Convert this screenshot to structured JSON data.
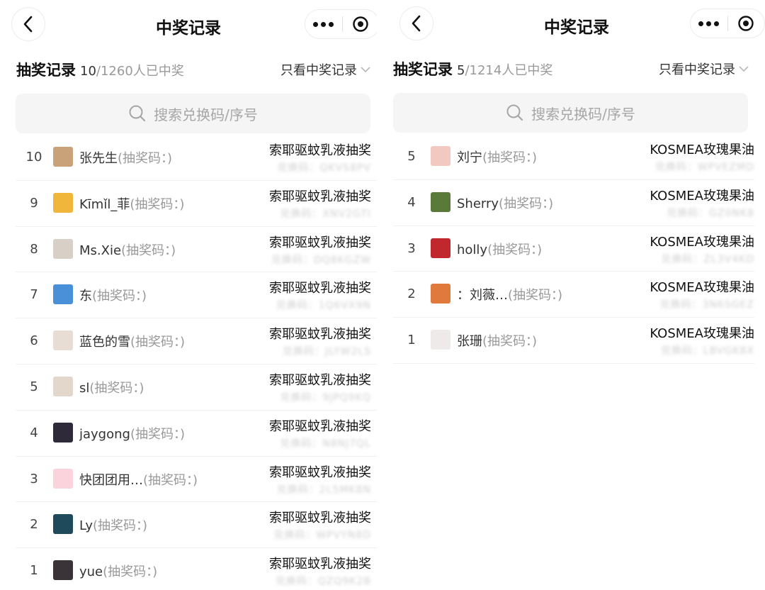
{
  "left": {
    "nav_title": "中奖记录",
    "summary_title": "抽奖记录",
    "summary_count": "10",
    "summary_total": "/1260人已中奖",
    "filter_label": "只看中奖记录",
    "search_placeholder": "搜索兑换码/序号",
    "rows": [
      {
        "index": "10",
        "name": "张先生",
        "code_label": "(抽奖码：)",
        "prize": "索耶驱蚊乳液抽奖",
        "code": "兑换码：QKVS8PV",
        "avatar_color": "#c9a27a"
      },
      {
        "index": "9",
        "name": "Kīmǐl_菲",
        "code_label": "(抽奖码：)",
        "prize": "索耶驱蚊乳液抽奖",
        "code": "兑换码：XNV2GTI",
        "avatar_color": "#f0b63c"
      },
      {
        "index": "8",
        "name": "Ms.Xie",
        "code_label": "(抽奖码：)",
        "prize": "索耶驱蚊乳液抽奖",
        "code": "兑换码：DQ8KGZW",
        "avatar_color": "#d8cfc6"
      },
      {
        "index": "7",
        "name": "东",
        "code_label": "(抽奖码：)",
        "prize": "索耶驱蚊乳液抽奖",
        "code": "兑换码：1Q6VX9N",
        "avatar_color": "#4a90d9"
      },
      {
        "index": "6",
        "name": "蓝色的雪",
        "code_label": "(抽奖码：)",
        "prize": "索耶驱蚊乳液抽奖",
        "code": "兑换码：JLYW2LS",
        "avatar_color": "#e8ddd4"
      },
      {
        "index": "5",
        "name": "sl",
        "code_label": "(抽奖码：)",
        "prize": "索耶驱蚊乳液抽奖",
        "code": "兑换码：9JPQ9KQ",
        "avatar_color": "#e3d7cc"
      },
      {
        "index": "4",
        "name": "jaygong",
        "code_label": "(抽奖码：)",
        "prize": "索耶驱蚊乳液抽奖",
        "code": "兑换码：N8NJ7QL",
        "avatar_color": "#2f2a3a"
      },
      {
        "index": "3",
        "name": "快团团用…",
        "code_label": "(抽奖码：)",
        "prize": "索耶驱蚊乳液抽奖",
        "code": "兑换码：2L5MK8N",
        "avatar_color": "#fbd3dc"
      },
      {
        "index": "2",
        "name": "Ly",
        "code_label": "(抽奖码：)",
        "prize": "索耶驱蚊乳液抽奖",
        "code": "兑换码：WPVYN8D",
        "avatar_color": "#1f4a5c"
      },
      {
        "index": "1",
        "name": "yue",
        "code_label": "(抽奖码：)",
        "prize": "索耶驱蚊乳液抽奖",
        "code": "兑换码：QZQ9K2B",
        "avatar_color": "#3a3338"
      }
    ]
  },
  "right": {
    "nav_title": "中奖记录",
    "summary_title": "抽奖记录",
    "summary_count": "5",
    "summary_total": "/1214人已中奖",
    "filter_label": "只看中奖记录",
    "search_placeholder": "搜索兑换码/序号",
    "rows": [
      {
        "index": "5",
        "name": "刘宁",
        "code_label": "(抽奖码：)",
        "prize": "KOSMEA玫瑰果油",
        "code": "兑换码：WPVEZMD",
        "avatar_color": "#f1c9c0"
      },
      {
        "index": "4",
        "name": "Sherry",
        "code_label": "(抽奖码：)",
        "prize": "KOSMEA玫瑰果油",
        "code": "兑换码：GZ0NK8",
        "avatar_color": "#5a7a3a"
      },
      {
        "index": "3",
        "name": "holly",
        "code_label": "(抽奖码：)",
        "prize": "KOSMEA玫瑰果油",
        "code": "兑换码：ZL3V4KD",
        "avatar_color": "#c0282e"
      },
      {
        "index": "2",
        "name": "：刘薇…",
        "code_label": "(抽奖码：)",
        "prize": "KOSMEA玫瑰果油",
        "code": "兑换码：3N6SGEZ",
        "avatar_color": "#e07a3c"
      },
      {
        "index": "1",
        "name": "张珊",
        "code_label": "(抽奖码：)",
        "prize": "KOSMEA玫瑰果油",
        "code": "兑换码：LBVGK8X",
        "avatar_color": "#eeeaea"
      }
    ]
  },
  "colors": {
    "accent_text": "#111111",
    "muted_text": "#999999",
    "search_bg": "#f5f5f5"
  }
}
